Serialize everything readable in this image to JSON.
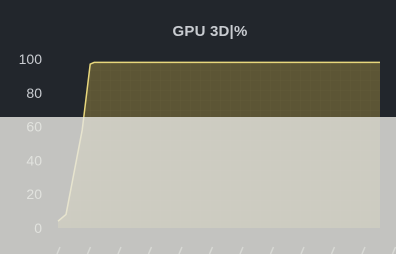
{
  "chart_data": {
    "type": "area",
    "title": "GPU 3D|%",
    "xlabel": "",
    "ylabel": "",
    "yticks": [
      "0",
      "20",
      "40",
      "60",
      "80",
      "100"
    ],
    "ylim": [
      0,
      100
    ],
    "x": [
      0,
      1,
      3,
      4,
      4.5,
      40
    ],
    "values": [
      4,
      8,
      58,
      97,
      98,
      98
    ],
    "xlim": [
      0,
      40
    ],
    "grid": true,
    "colors": {
      "background": "#22262c",
      "line": "#e8d77c",
      "fill": "#5c5535",
      "overlay": "#e6e6e0"
    }
  }
}
